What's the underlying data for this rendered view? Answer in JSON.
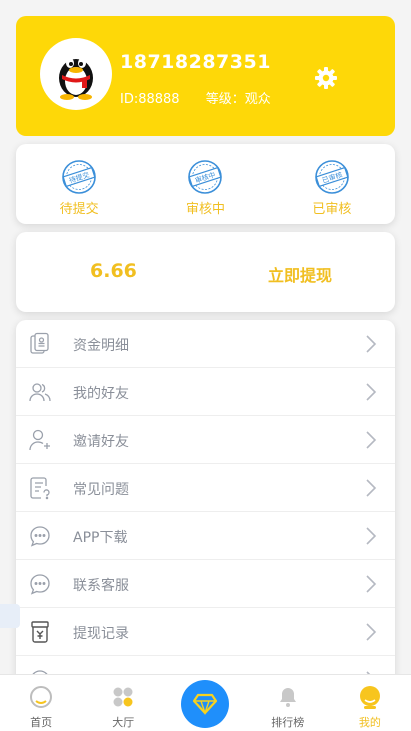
{
  "profile": {
    "phone": "18718287351",
    "id_text": "ID:88888",
    "level_text": "等级：观众",
    "avatar_icon": "qq-penguin-avatar",
    "settings_icon": "gear-icon"
  },
  "status": {
    "items": [
      {
        "label": "待提交",
        "stamp": "待提交",
        "icon": "stamp-pending-submit-icon"
      },
      {
        "label": "审核中",
        "stamp": "审核中",
        "icon": "stamp-reviewing-icon"
      },
      {
        "label": "已审核",
        "stamp": "已审核",
        "icon": "stamp-reviewed-icon"
      }
    ]
  },
  "money": {
    "balance": "6.66",
    "withdraw_label": "立即提现"
  },
  "menu": {
    "items": [
      {
        "label": "资金明细",
        "icon": "funds-detail-icon"
      },
      {
        "label": "我的好友",
        "icon": "friends-icon"
      },
      {
        "label": "邀请好友",
        "icon": "invite-friend-icon"
      },
      {
        "label": "常见问题",
        "icon": "faq-icon"
      },
      {
        "label": "APP下载",
        "icon": "app-download-icon"
      },
      {
        "label": "联系客服",
        "icon": "customer-service-icon"
      },
      {
        "label": "提现记录",
        "icon": "withdraw-record-icon"
      }
    ]
  },
  "tabbar": {
    "items": [
      {
        "label": "首页",
        "icon": "home-icon"
      },
      {
        "label": "大厅",
        "icon": "hall-icon"
      },
      {
        "label": "",
        "icon": "diamond-icon"
      },
      {
        "label": "排行榜",
        "icon": "bell-icon"
      },
      {
        "label": "我的",
        "icon": "user-icon",
        "active": true
      }
    ]
  },
  "colors": {
    "brand_yellow": "#fed808",
    "text_yellow": "#f1bf21",
    "center_blue": "#1f8ffb",
    "stamp_blue": "#3b8fd9"
  }
}
